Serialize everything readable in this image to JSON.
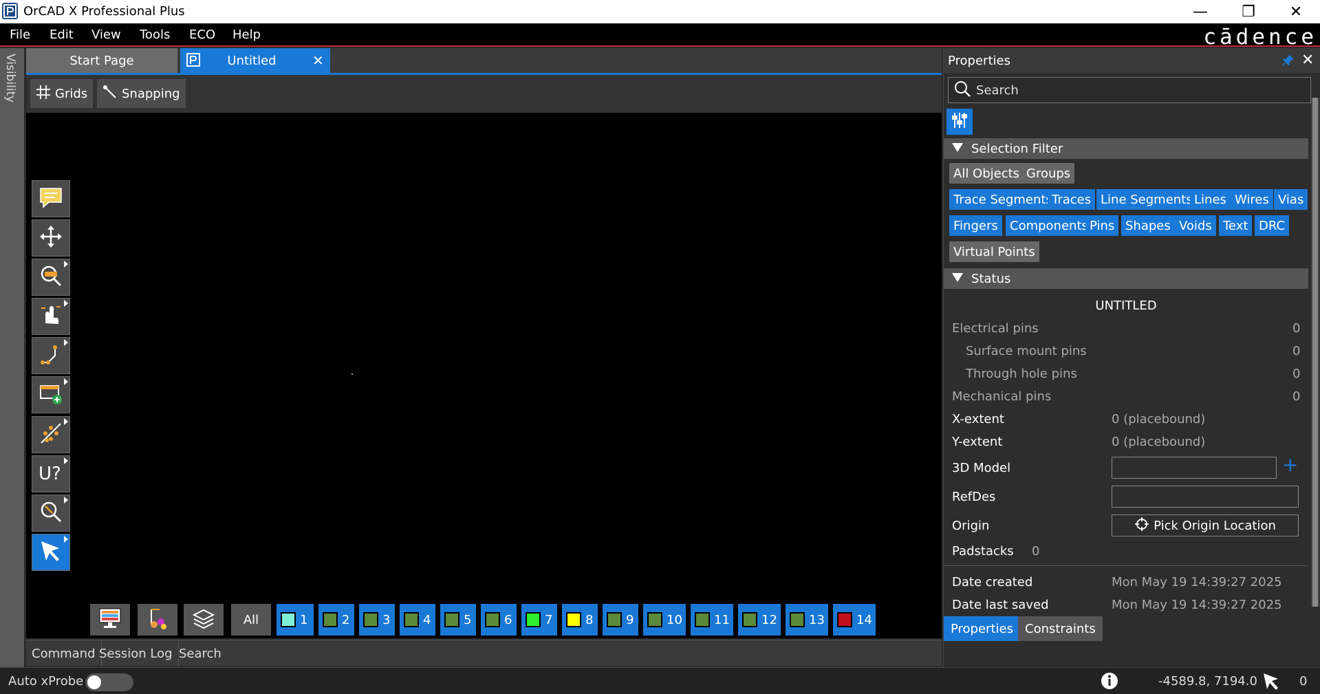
{
  "window": {
    "title": "OrCAD X Professional Plus",
    "minimize_glyph": "—",
    "maximize_glyph": "❐",
    "close_glyph": "✕"
  },
  "menu": [
    "File",
    "Edit",
    "View",
    "Tools",
    "ECO",
    "Help"
  ],
  "brand": "cādence",
  "visibility_label": "Visibility",
  "tabs": {
    "start": "Start Page",
    "untitled": "Untitled",
    "close_glyph": "✕"
  },
  "toolbar": {
    "grids": "Grids",
    "snapping": "Snapping"
  },
  "tools": [
    "comment-icon",
    "move-icon",
    "zoom-rect-icon",
    "pan-hand-icon",
    "route-icon",
    "add-component-icon",
    "ratsnest-icon",
    "refdes-query-icon",
    "zoom-fit-icon",
    "select-pointer-icon"
  ],
  "layer_bar": {
    "all_label": "All",
    "layers": [
      {
        "label": "1",
        "color": "#7ff0d8"
      },
      {
        "label": "2",
        "color": "#5a8a3a"
      },
      {
        "label": "3",
        "color": "#5a8a3a"
      },
      {
        "label": "4",
        "color": "#5a8a3a"
      },
      {
        "label": "5",
        "color": "#5a8a3a"
      },
      {
        "label": "6",
        "color": "#5a8a3a"
      },
      {
        "label": "7",
        "color": "#2ef02e"
      },
      {
        "label": "8",
        "color": "#ffff00"
      },
      {
        "label": "9",
        "color": "#5a8a3a"
      },
      {
        "label": "10",
        "color": "#5a8a3a"
      },
      {
        "label": "11",
        "color": "#5a8a3a"
      },
      {
        "label": "12",
        "color": "#5a8a3a"
      },
      {
        "label": "13",
        "color": "#5a8a3a"
      },
      {
        "label": "14",
        "color": "#c01020"
      }
    ]
  },
  "command_tabs": [
    "Command",
    "Session Log",
    "Search"
  ],
  "status": {
    "xprobe_label": "Auto xProbe",
    "coords": "-4589.8, 7194.0",
    "selection_count": "0"
  },
  "properties": {
    "title": "Properties",
    "search_placeholder": "Search",
    "selection_filter_title": "Selection Filter",
    "filter_chips_row1": [
      {
        "label": "All Objects"
      },
      {
        "label": "Groups"
      }
    ],
    "filter_chips_row2": [
      "Trace Segments",
      "Traces",
      "Line Segments",
      "Lines",
      "Wires",
      "Vias"
    ],
    "filter_chips_row3": [
      "Fingers",
      "Components",
      "Pins",
      "Shapes",
      "Voids",
      "Text",
      "DRC"
    ],
    "filter_chips_row4": [
      "Virtual Points"
    ],
    "status_title": "Status",
    "design_name": "UNTITLED",
    "electrical_pins_label": "Electrical pins",
    "electrical_pins": "0",
    "smt_pins_label": "Surface mount pins",
    "smt_pins": "0",
    "th_pins_label": "Through hole pins",
    "th_pins": "0",
    "mech_pins_label": "Mechanical pins",
    "mech_pins": "0",
    "x_extent_label": "X-extent",
    "x_extent": "0 (placebound)",
    "y_extent_label": "Y-extent",
    "y_extent": "0 (placebound)",
    "model3d_label": "3D Model",
    "model3d_value": "",
    "refdes_label": "RefDes",
    "refdes_value": "",
    "origin_label": "Origin",
    "pick_origin_label": "Pick Origin Location",
    "padstacks_label": "Padstacks",
    "padstacks": "0",
    "date_created_label": "Date created",
    "date_created": "Mon May 19 14:39:27 2025",
    "date_saved_label": "Date last saved",
    "date_saved": "Mon May 19 14:39:27 2025",
    "tab_properties": "Properties",
    "tab_constraints": "Constraints"
  }
}
